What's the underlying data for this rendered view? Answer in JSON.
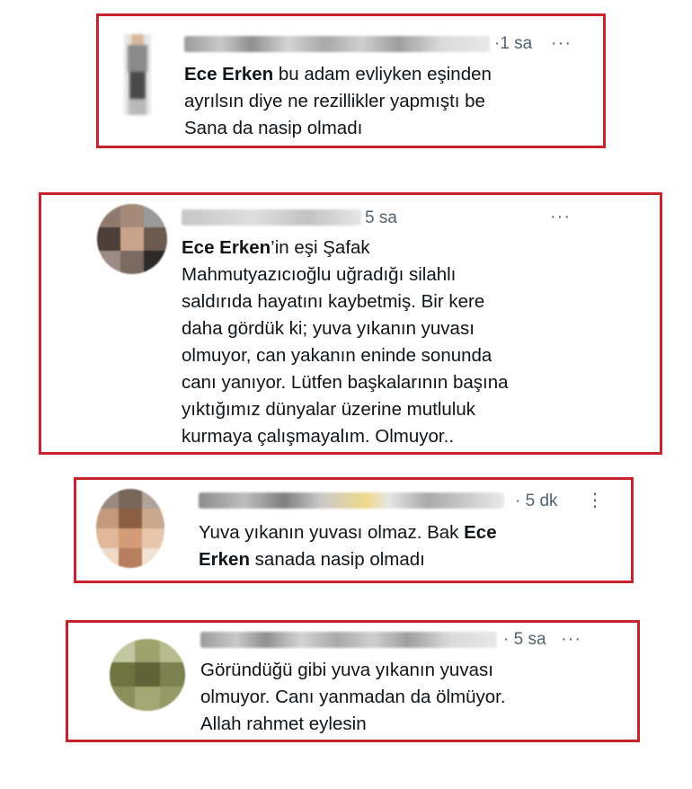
{
  "tweets": [
    {
      "time": "·1 sa",
      "more": "···",
      "mention": "Ece Erken",
      "line1_rest": " bu adam evliyken eşinden",
      "line2": "ayrılsın diye ne rezillikler yapmıştı be",
      "line3": "Sana da nasip olmadı"
    },
    {
      "time": "5 sa",
      "more": "···",
      "mention": "Ece Erken",
      "line1_rest": "’in eşi Şafak",
      "lines": [
        "Mahmutyazıcıoğlu uğradığı silahlı",
        "saldırıda hayatını kaybetmiş. Bir kere",
        "daha gördük ki; yuva yıkanın yuvası",
        "olmuyor, can yakanın eninde sonunda",
        "canı yanıyor. Lütfen başkalarının başına",
        "yıktığımız dünyalar üzerine mutluluk",
        "kurmaya çalışmayalım. Olmuyor.."
      ]
    },
    {
      "time": "· 5 dk",
      "more": "⋮",
      "line1_pre": "Yuva yıkanın yuvası olmaz. Bak ",
      "mention_a": "Ece",
      "mention_b": "Erken",
      "line2_rest": " sanada nasip olmadı"
    },
    {
      "time": "· 5 sa",
      "more": "···",
      "line1": "Göründüğü gibi yuva yıkanın yuvası",
      "line2": "olmuyor. Canı yanmadan da ölmüyor.",
      "line3": "Allah rahmet eylesin"
    }
  ]
}
